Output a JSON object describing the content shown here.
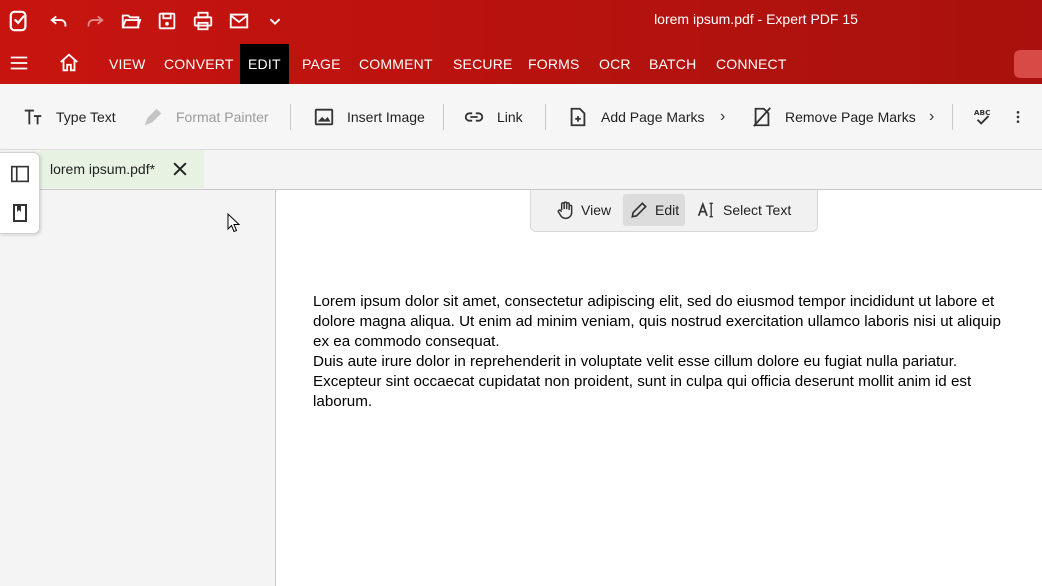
{
  "window": {
    "title": "lorem ipsum.pdf   -   Expert PDF 15"
  },
  "quick_access": [
    "app-logo-icon",
    "undo-icon",
    "redo-icon",
    "open-folder-icon",
    "save-icon",
    "print-icon",
    "mail-icon",
    "chevron-down-icon"
  ],
  "menu": {
    "tabs": [
      "VIEW",
      "CONVERT",
      "EDIT",
      "PAGE",
      "COMMENT",
      "SECURE",
      "FORMS",
      "OCR",
      "BATCH",
      "CONNECT"
    ],
    "active": "EDIT"
  },
  "toolbar": {
    "type_text": "Type Text",
    "format_painter": "Format Painter",
    "insert_image": "Insert Image",
    "link": "Link",
    "add_page_marks": "Add Page Marks",
    "remove_page_marks": "Remove Page Marks",
    "chevron": "›"
  },
  "document_tab": {
    "name": "lorem ipsum.pdf*"
  },
  "modes": {
    "view": "View",
    "edit": "Edit",
    "select_text": "Select Text",
    "active": "Edit"
  },
  "document": {
    "lines": [
      "Lorem ipsum dolor sit amet, consectetur adipiscing elit, sed do eiusmod tempor incididunt ut labore et",
      "dolore magna aliqua. Ut enim ad minim veniam, quis nostrud exercitation ullamco laboris nisi ut aliquip",
      "ex ea commodo consequat.",
      "Duis aute irure dolor in reprehenderit in voluptate velit esse cillum dolore eu fugiat nulla pariatur.",
      "Excepteur sint occaecat cupidatat non proident, sunt in culpa qui officia deserunt mollit anim id est",
      "laborum."
    ]
  },
  "colors": {
    "brand_red": "#c8140f",
    "active_tab": "#000000",
    "doc_tab_bg": "#e7f2e3"
  }
}
